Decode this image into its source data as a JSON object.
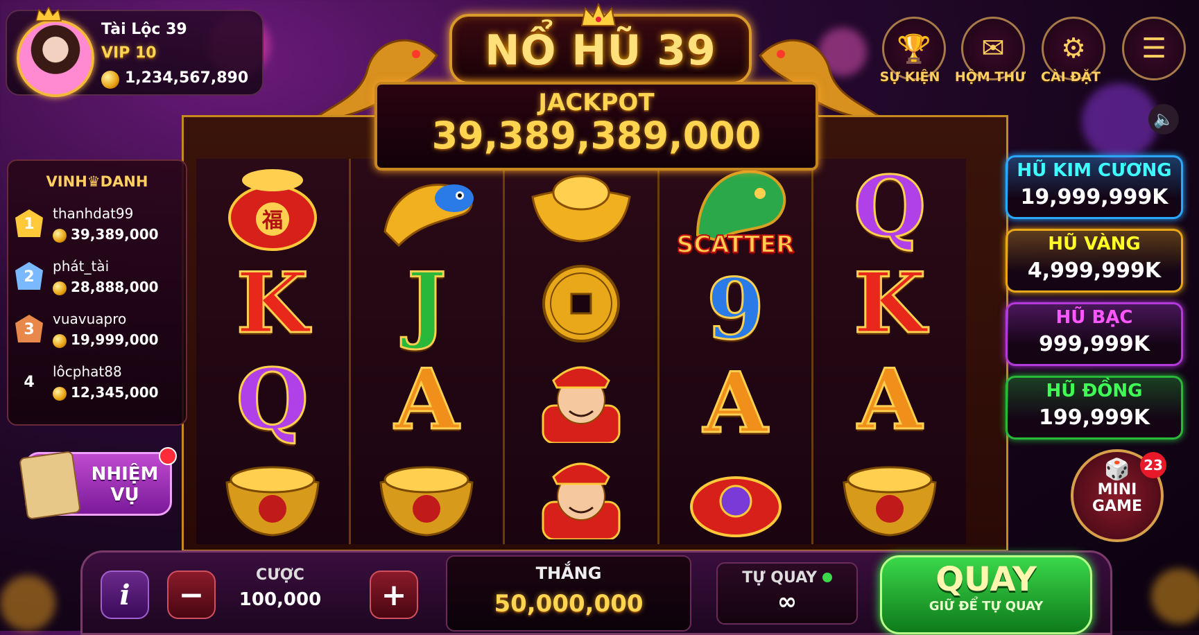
{
  "player": {
    "name": "Tài Lộc 39",
    "vip": "VIP 10",
    "balance": "1,234,567,890"
  },
  "title": {
    "game_name": "NỔ HŨ 39",
    "jackpot_label": "JACKPOT",
    "jackpot_value": "39,389,389,000"
  },
  "top_menu": [
    {
      "label": "SỰ KIỆN",
      "icon": "trophy-icon"
    },
    {
      "label": "HỘM THƯ",
      "icon": "mail-icon"
    },
    {
      "label": "CÀI ĐẶT",
      "icon": "gear-icon"
    },
    {
      "label": "",
      "icon": "menu-icon"
    }
  ],
  "leaderboard": {
    "title_left": "VINH",
    "title_right": "DANH",
    "entries": [
      {
        "rank": "1",
        "name": "thanhdat99",
        "amount": "39,389,000"
      },
      {
        "rank": "2",
        "name": "phát_tài",
        "amount": "28,888,000"
      },
      {
        "rank": "3",
        "name": "vuavuapro",
        "amount": "19,999,000"
      },
      {
        "rank": "4",
        "name": "lôcphat88",
        "amount": "12,345,000"
      }
    ]
  },
  "mission": {
    "line1": "NHIỆM",
    "line2": "VỤ"
  },
  "reels": [
    [
      "fortune-bag",
      "K",
      "Q",
      "gold-pot"
    ],
    [
      "golden-fish",
      "J",
      "A",
      "gold-pot"
    ],
    [
      "gold-ingot",
      "coin",
      "god-of-wealth",
      "god-of-wealth"
    ],
    [
      "dragon-scatter",
      "9",
      "A",
      "gold-bag"
    ],
    [
      "Q",
      "K",
      "A",
      "gold-pot"
    ]
  ],
  "scatter_label": "SCATTER",
  "fortune_char": "福",
  "jackpots": [
    {
      "name": "HŨ KIM CƯƠNG",
      "value": "19,999,999K",
      "color": "#2aa8ff"
    },
    {
      "name": "HŨ VÀNG",
      "value": "4,999,999K",
      "color": "#e8a81a"
    },
    {
      "name": "HŨ BẠC",
      "value": "999,999K",
      "color": "#b23ad8"
    },
    {
      "name": "HŨ ĐỒNG",
      "value": "199,999K",
      "color": "#2ab83a"
    }
  ],
  "mini_game": {
    "line1": "MINI",
    "line2": "GAME",
    "badge": "23"
  },
  "controls": {
    "info": "i",
    "minus": "−",
    "plus": "+",
    "bet_label": "CƯỢC",
    "bet_value": "100,000",
    "win_label": "THẮNG",
    "win_value": "50,000,000",
    "auto_label": "TỰ QUAY",
    "auto_value": "∞",
    "spin_label": "QUAY",
    "spin_sub": "GIỮ ĐỂ TỰ QUAY"
  }
}
